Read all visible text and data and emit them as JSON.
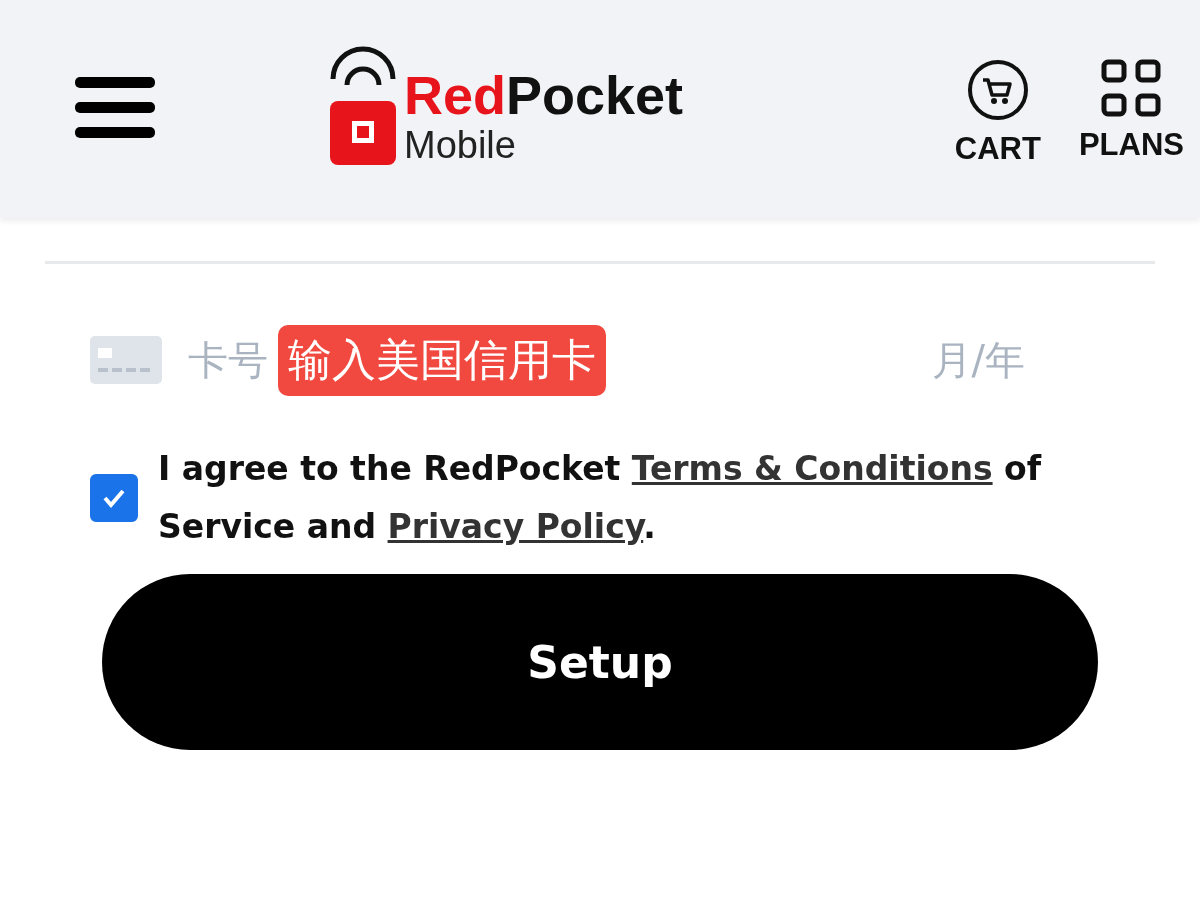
{
  "header": {
    "logo": {
      "name_first": "Red",
      "name_second": "Pocket",
      "tagline": "Mobile"
    },
    "actions": [
      {
        "kind": "cart",
        "label": "CART"
      },
      {
        "kind": "plans",
        "label": "PLANS"
      }
    ]
  },
  "payment": {
    "card_placeholder": "卡号",
    "annotation": "输入美国信用卡",
    "expiry_placeholder": "月/年"
  },
  "agreement": {
    "checked": true,
    "parts": [
      {
        "kind": "text",
        "text": "I agree to the RedPocket "
      },
      {
        "kind": "link",
        "text": "Terms & Conditions"
      },
      {
        "kind": "text",
        "text": " of Service and "
      },
      {
        "kind": "link",
        "text": "Privacy Policy"
      },
      {
        "kind": "text",
        "text": "."
      }
    ]
  },
  "button": {
    "label": "Setup"
  }
}
